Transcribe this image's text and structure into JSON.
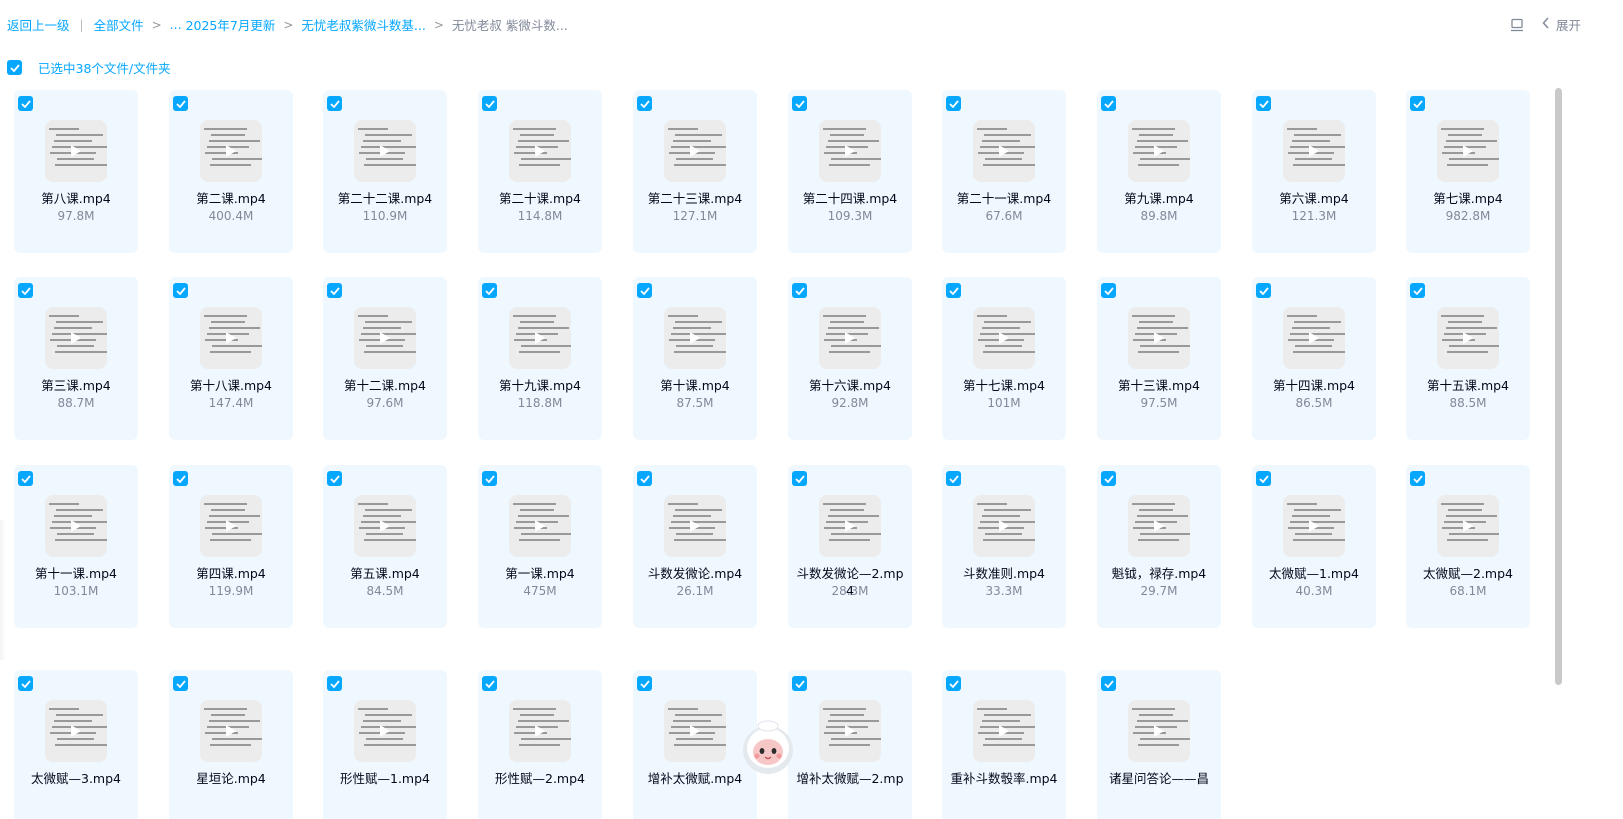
{
  "breadcrumb": {
    "back": "返回上一级",
    "all_files": "全部文件",
    "ellipsis": "...",
    "level1": "2025年7月更新",
    "level2": "无忧老叔紫微斗数基...",
    "current": "无忧老叔 紫微斗数..."
  },
  "toolbar": {
    "expand_label": "展开",
    "list_view_icon": "list-view-icon",
    "collapse_icon": "chevron-left-icon"
  },
  "selection": {
    "label": "已选中38个文件/文件夹",
    "checked": true
  },
  "colors": {
    "accent": "#06a7ff",
    "card_bg": "#f0f8ff",
    "text": "#03081a",
    "muted": "#818999"
  },
  "files": [
    {
      "name": "第八课.mp4",
      "size": "97.8M"
    },
    {
      "name": "第二课.mp4",
      "size": "400.4M"
    },
    {
      "name": "第二十二课.mp4",
      "size": "110.9M"
    },
    {
      "name": "第二十课.mp4",
      "size": "114.8M"
    },
    {
      "name": "第二十三课.mp4",
      "size": "127.1M"
    },
    {
      "name": "第二十四课.mp4",
      "size": "109.3M"
    },
    {
      "name": "第二十一课.mp4",
      "size": "67.6M"
    },
    {
      "name": "第九课.mp4",
      "size": "89.8M"
    },
    {
      "name": "第六课.mp4",
      "size": "121.3M"
    },
    {
      "name": "第七课.mp4",
      "size": "982.8M"
    },
    {
      "name": "第三课.mp4",
      "size": "88.7M"
    },
    {
      "name": "第十八课.mp4",
      "size": "147.4M"
    },
    {
      "name": "第十二课.mp4",
      "size": "97.6M"
    },
    {
      "name": "第十九课.mp4",
      "size": "118.8M"
    },
    {
      "name": "第十课.mp4",
      "size": "87.5M"
    },
    {
      "name": "第十六课.mp4",
      "size": "92.8M"
    },
    {
      "name": "第十七课.mp4",
      "size": "101M"
    },
    {
      "name": "第十三课.mp4",
      "size": "97.5M"
    },
    {
      "name": "第十四课.mp4",
      "size": "86.5M"
    },
    {
      "name": "第十五课.mp4",
      "size": "88.5M"
    },
    {
      "name": "第十一课.mp4",
      "size": "103.1M"
    },
    {
      "name": "第四课.mp4",
      "size": "119.9M"
    },
    {
      "name": "第五课.mp4",
      "size": "84.5M"
    },
    {
      "name": "第一课.mp4",
      "size": "475M"
    },
    {
      "name": "斗数发微论.mp4",
      "size": "26.1M"
    },
    {
      "name": "斗数发微论—2.mp4",
      "size": "28.3M"
    },
    {
      "name": "斗数准则.mp4",
      "size": "33.3M"
    },
    {
      "name": "魁钺，禄存.mp4",
      "size": "29.7M"
    },
    {
      "name": "太微赋—1.mp4",
      "size": "40.3M"
    },
    {
      "name": "太微赋—2.mp4",
      "size": "68.1M"
    },
    {
      "name": "太微赋—3.mp4",
      "size": ""
    },
    {
      "name": "星垣论.mp4",
      "size": ""
    },
    {
      "name": "形性赋—1.mp4",
      "size": ""
    },
    {
      "name": "形性赋—2.mp4",
      "size": ""
    },
    {
      "name": "增补太微赋.mp4",
      "size": ""
    },
    {
      "name": "增补太微赋—2.mp",
      "size": ""
    },
    {
      "name": "重补斗数彀率.mp4",
      "size": ""
    },
    {
      "name": "诸星问答论——昌",
      "size": ""
    }
  ]
}
